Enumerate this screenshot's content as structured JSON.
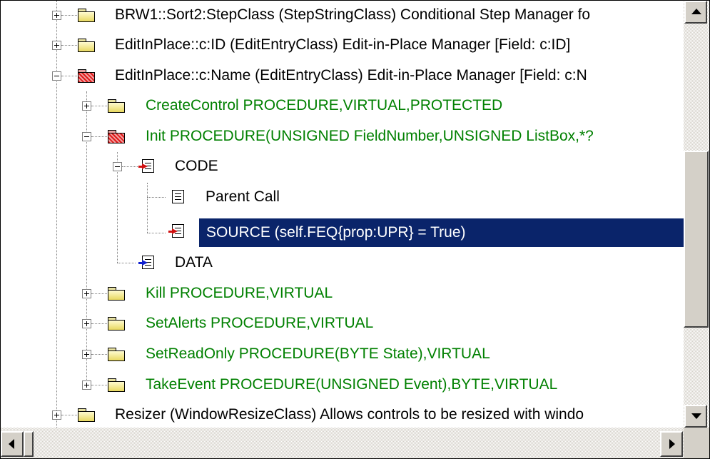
{
  "tree": {
    "rows": [
      {
        "label": "BRW1::Sort2:StepClass  (StepStringClass)  Conditional Step Manager fo",
        "color": "black",
        "icon": "folder-closed-icon",
        "expander": "plus"
      },
      {
        "label": "EditInPlace::c:ID  (EditEntryClass)  Edit-in-Place Manager  [Field: c:ID]",
        "color": "black",
        "icon": "folder-closed-icon",
        "expander": "plus"
      },
      {
        "label": "EditInPlace::c:Name  (EditEntryClass)  Edit-in-Place Manager  [Field: c:N",
        "color": "black",
        "icon": "folder-open-icon",
        "expander": "minus"
      },
      {
        "label": "CreateControl PROCEDURE,VIRTUAL,PROTECTED",
        "color": "green",
        "icon": "folder-closed-icon",
        "expander": "plus"
      },
      {
        "label": "Init PROCEDURE(UNSIGNED FieldNumber,UNSIGNED ListBox,*?",
        "color": "green",
        "icon": "folder-open-icon",
        "expander": "minus"
      },
      {
        "label": "CODE",
        "color": "black",
        "icon": "code-embed-icon",
        "expander": "minus"
      },
      {
        "label": "Parent Call",
        "color": "black",
        "icon": "document-icon",
        "expander": "none"
      },
      {
        "label": "SOURCE (self.FEQ{prop:UPR} = True)",
        "color": "black",
        "icon": "source-embed-icon",
        "expander": "none",
        "selected": true
      },
      {
        "label": "DATA",
        "color": "black",
        "icon": "data-embed-icon",
        "expander": "none"
      },
      {
        "label": "Kill PROCEDURE,VIRTUAL",
        "color": "green",
        "icon": "folder-closed-icon",
        "expander": "plus"
      },
      {
        "label": "SetAlerts PROCEDURE,VIRTUAL",
        "color": "green",
        "icon": "folder-closed-icon",
        "expander": "plus"
      },
      {
        "label": "SetReadOnly PROCEDURE(BYTE State),VIRTUAL",
        "color": "green",
        "icon": "folder-closed-icon",
        "expander": "plus"
      },
      {
        "label": "TakeEvent PROCEDURE(UNSIGNED Event),BYTE,VIRTUAL",
        "color": "green",
        "icon": "folder-closed-icon",
        "expander": "plus"
      },
      {
        "label": "Resizer  (WindowResizeClass)  Allows controls to be resized with windo",
        "color": "black",
        "icon": "folder-closed-icon",
        "expander": "plus"
      }
    ]
  },
  "colors": {
    "selection_bg": "#0a246a",
    "green_text": "#008000",
    "scrollbar_face": "#d4d0c8"
  }
}
